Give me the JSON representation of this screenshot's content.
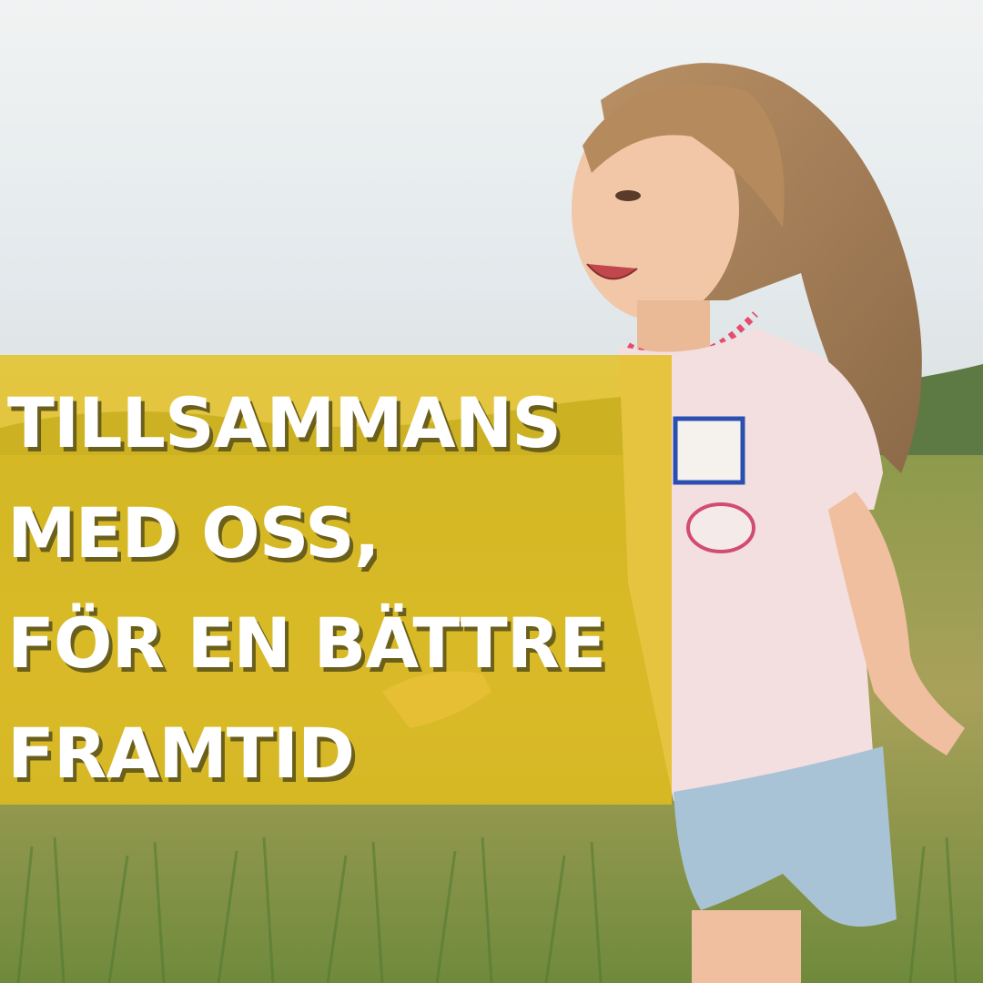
{
  "headline": {
    "lines": [
      "TILLSAMMANS",
      "MED OSS,",
      "FÖR EN BÄTTRE",
      "FRAMTID"
    ]
  },
  "photo": {
    "subject": "smiling-girl-running-in-field",
    "sky_color": "#e9eef0",
    "field_color": "#7a8a3a"
  },
  "colors": {
    "overlay": "#e4be1c",
    "text": "#ffffff",
    "text_shadow": "#6b5f1c"
  }
}
